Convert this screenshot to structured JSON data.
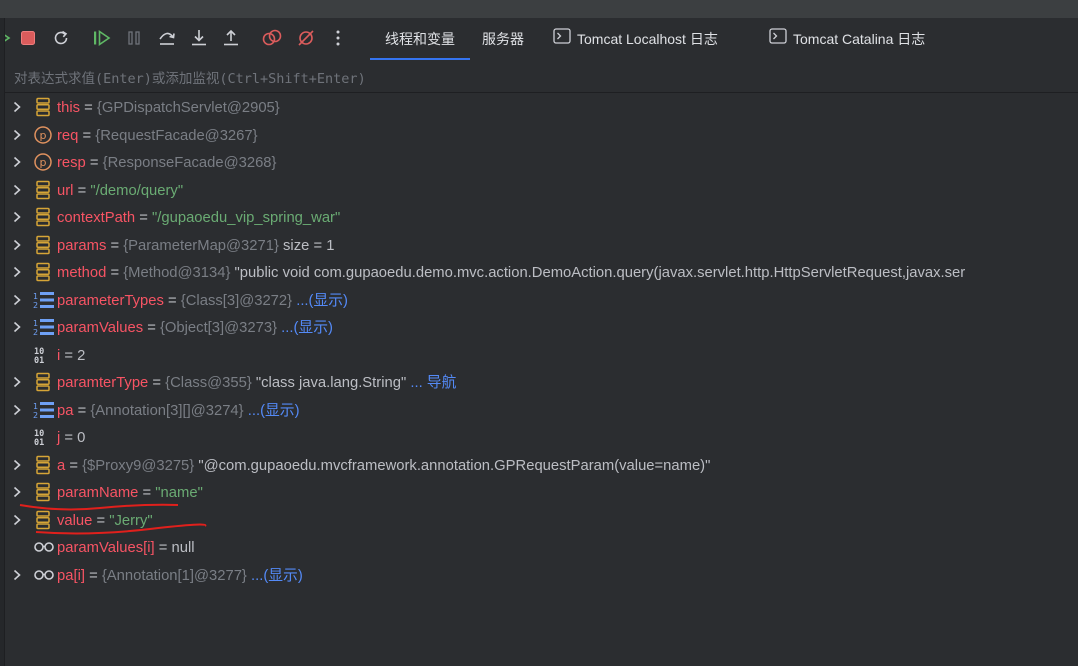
{
  "tabs": [
    {
      "label": "线程和变量",
      "active": true
    },
    {
      "label": "服务器",
      "active": false
    },
    {
      "label": "Tomcat Localhost 日志",
      "active": false,
      "icon": "terminal-icon"
    },
    {
      "label": "Tomcat Catalina 日志",
      "active": false,
      "icon": "terminal-icon"
    }
  ],
  "toolbar_icons": [
    "rerun-icon",
    "stop-icon",
    "restart-icon",
    "resume-icon",
    "pause-icon",
    "step-over-icon",
    "step-into-icon",
    "step-out-icon",
    "view-breakpoints-icon",
    "mute-breakpoints-icon",
    "more-vertical-icon"
  ],
  "eval_placeholder": "对表达式求值(Enter)或添加监视(Ctrl+Shift+Enter)",
  "colors": {
    "name": "#f75464",
    "string": "#6aab73",
    "link": "#548af7",
    "ref": "#7a7e85",
    "annotation": "#e0201c"
  },
  "variables": [
    {
      "expandable": true,
      "icon": "field-icon",
      "name": "this",
      "ref": "{GPDispatchServlet@2905}",
      "value": "",
      "value_type": "",
      "link": "",
      "extra": ""
    },
    {
      "expandable": true,
      "icon": "parameter-icon",
      "name": "req",
      "ref": "{RequestFacade@3267}",
      "value": "",
      "value_type": "",
      "link": "",
      "extra": ""
    },
    {
      "expandable": true,
      "icon": "parameter-icon",
      "name": "resp",
      "ref": "{ResponseFacade@3268}",
      "value": "",
      "value_type": "",
      "link": "",
      "extra": ""
    },
    {
      "expandable": true,
      "icon": "field-icon",
      "name": "url",
      "ref": "",
      "value": "\"/demo/query\"",
      "value_type": "string",
      "link": "",
      "extra": ""
    },
    {
      "expandable": true,
      "icon": "field-icon",
      "name": "contextPath",
      "ref": "",
      "value": "\"/gupaoedu_vip_spring_war\"",
      "value_type": "string",
      "link": "",
      "extra": ""
    },
    {
      "expandable": true,
      "icon": "field-icon",
      "name": "params",
      "ref": "{ParameterMap@3271}",
      "value": "",
      "value_type": "",
      "link": "",
      "extra": "size = 1"
    },
    {
      "expandable": true,
      "icon": "field-icon",
      "name": "method",
      "ref": "{Method@3134}",
      "value": "\"public void com.gupaoedu.demo.mvc.action.DemoAction.query(javax.servlet.http.HttpServletRequest,javax.ser",
      "value_type": "plain",
      "link": "",
      "extra": ""
    },
    {
      "expandable": true,
      "icon": "array-icon",
      "name": "parameterTypes",
      "ref": "{Class[3]@3272}",
      "value": "",
      "value_type": "",
      "link": "...(显示)",
      "extra": ""
    },
    {
      "expandable": true,
      "icon": "array-icon",
      "name": "paramValues",
      "ref": "{Object[3]@3273}",
      "value": "",
      "value_type": "",
      "link": "...(显示)",
      "extra": ""
    },
    {
      "expandable": false,
      "icon": "primitive-icon",
      "name": "i",
      "ref": "",
      "value": "2",
      "value_type": "plain",
      "link": "",
      "extra": ""
    },
    {
      "expandable": true,
      "icon": "field-icon",
      "name": "paramterType",
      "ref": "{Class@355}",
      "value": "\"class java.lang.String\"",
      "value_type": "plain",
      "link": "... 导航",
      "extra": ""
    },
    {
      "expandable": true,
      "icon": "array-icon",
      "name": "pa",
      "ref": "{Annotation[3][]@3274}",
      "value": "",
      "value_type": "",
      "link": "...(显示)",
      "extra": ""
    },
    {
      "expandable": false,
      "icon": "primitive-icon",
      "name": "j",
      "ref": "",
      "value": "0",
      "value_type": "plain",
      "link": "",
      "extra": ""
    },
    {
      "expandable": true,
      "icon": "field-icon",
      "name": "a",
      "ref": "{$Proxy9@3275}",
      "value": "\"@com.gupaoedu.mvcframework.annotation.GPRequestParam(value=name)\"",
      "value_type": "plain",
      "link": "",
      "extra": ""
    },
    {
      "expandable": true,
      "icon": "field-icon",
      "name": "paramName",
      "ref": "",
      "value": "\"name\"",
      "value_type": "string",
      "link": "",
      "extra": ""
    },
    {
      "expandable": true,
      "icon": "field-icon",
      "name": "value",
      "ref": "",
      "value": "\"Jerry\"",
      "value_type": "string",
      "link": "",
      "extra": ""
    },
    {
      "expandable": false,
      "icon": "watch-icon",
      "name": "paramValues[i]",
      "ref": "",
      "value": "null",
      "value_type": "plain",
      "link": "",
      "extra": ""
    },
    {
      "expandable": true,
      "icon": "watch-icon",
      "name": "pa[i]",
      "ref": "{Annotation[1]@3277}",
      "value": "",
      "value_type": "",
      "link": "...(显示)",
      "extra": ""
    }
  ]
}
